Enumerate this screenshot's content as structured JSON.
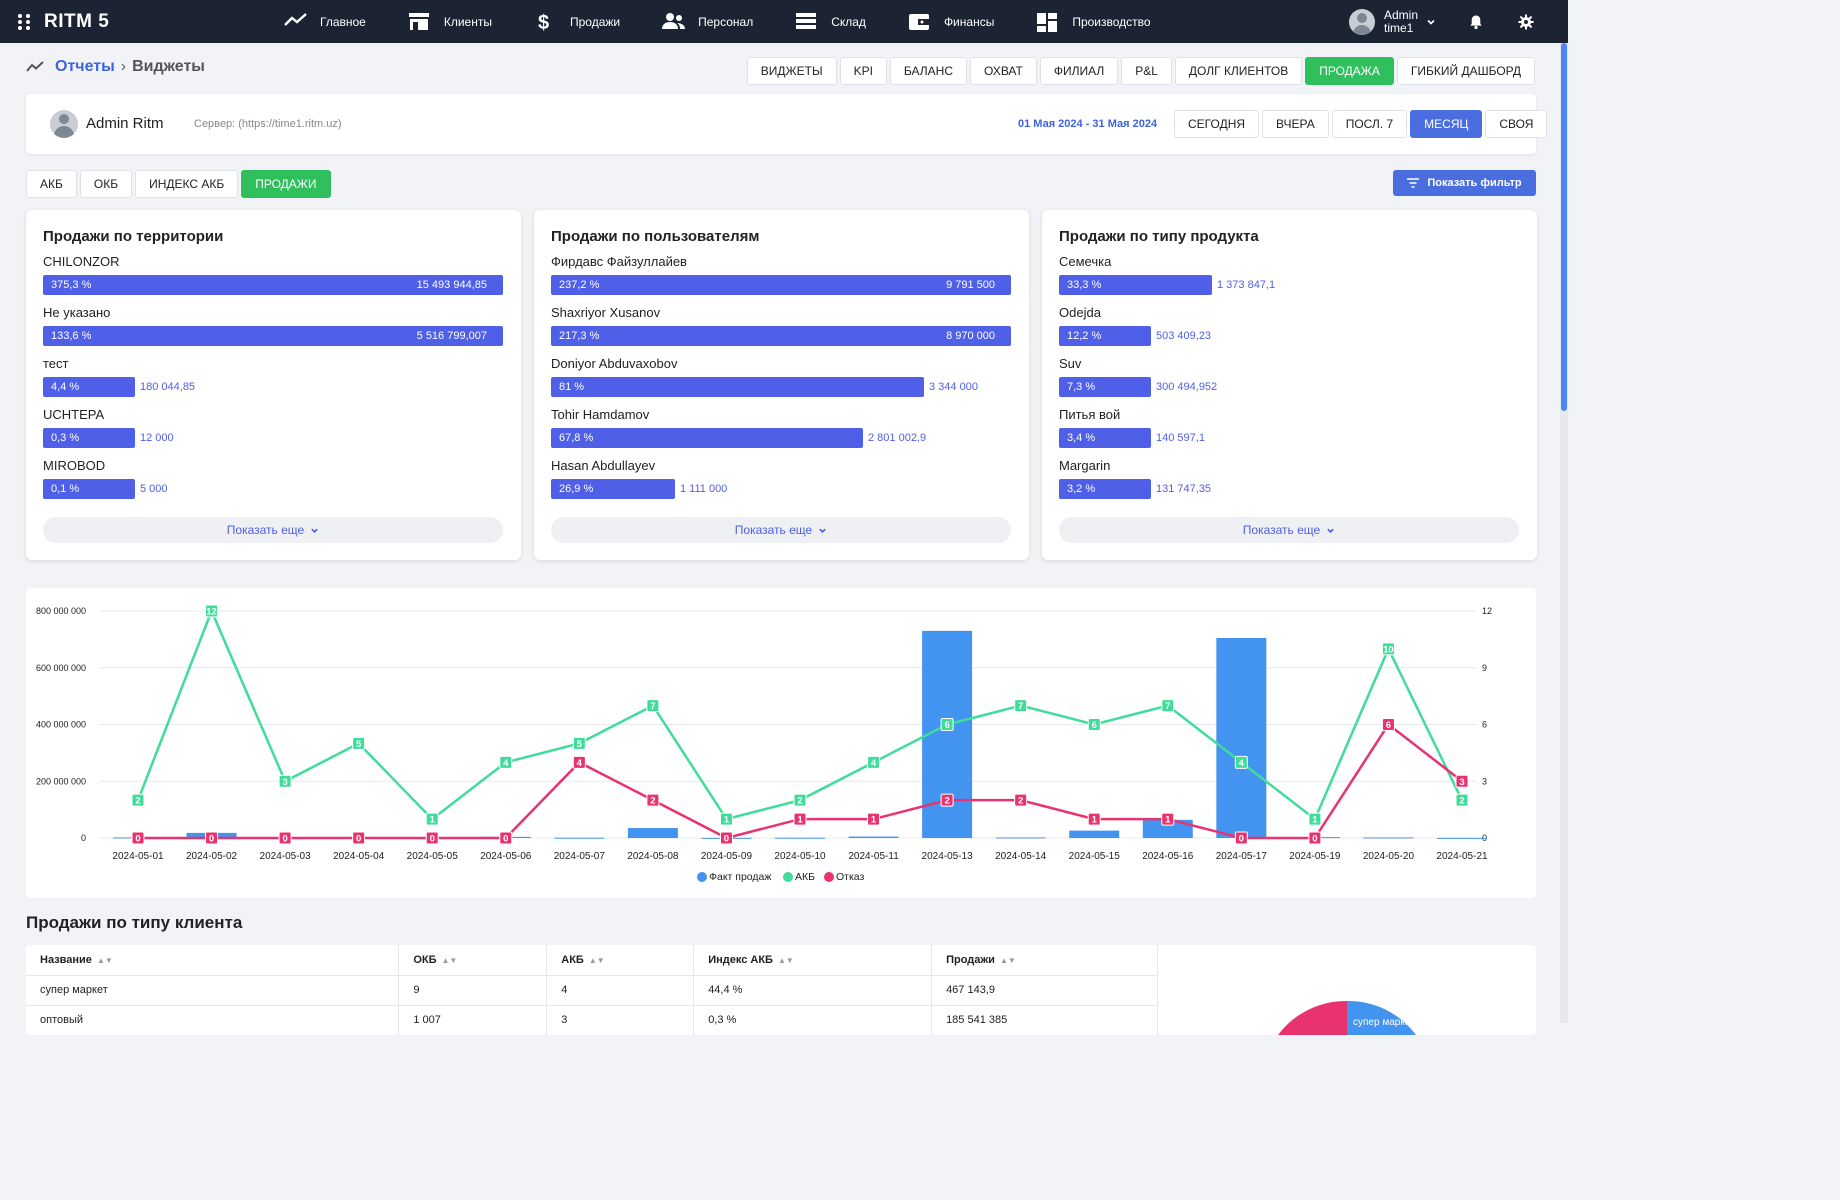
{
  "app": {
    "name": "RITM 5"
  },
  "nav": [
    {
      "label": "Главное",
      "icon": "trend-line-icon"
    },
    {
      "label": "Клиенты",
      "icon": "store-icon"
    },
    {
      "label": "Продажи",
      "icon": "dollar-icon"
    },
    {
      "label": "Персонал",
      "icon": "people-icon"
    },
    {
      "label": "Склад",
      "icon": "warehouse-icon"
    },
    {
      "label": "Финансы",
      "icon": "wallet-icon"
    },
    {
      "label": "Производство",
      "icon": "dashboard-blocks-icon"
    }
  ],
  "user": {
    "name": "Admin",
    "server": "time1"
  },
  "breadcrumb": {
    "parent": "Отчеты",
    "separator": "›",
    "current": "Виджеты"
  },
  "top_tabs": [
    {
      "label": "ВИДЖЕТЫ",
      "active": false
    },
    {
      "label": "KPI",
      "active": false
    },
    {
      "label": "БАЛАНС",
      "active": false
    },
    {
      "label": "ОХВАТ",
      "active": false
    },
    {
      "label": "ФИЛИАЛ",
      "active": false
    },
    {
      "label": "P&L",
      "active": false
    },
    {
      "label": "ДОЛГ КЛИЕНТОВ",
      "active": false
    },
    {
      "label": "ПРОДАЖА",
      "active": true
    },
    {
      "label": "ГИБКИЙ ДАШБОРД",
      "active": false
    }
  ],
  "user_card": {
    "name": "Admin Ritm",
    "server": "Сервер: (https://time1.ritm.uz)",
    "date_range": "01 Мая 2024 - 31 Мая 2024",
    "periods": [
      {
        "label": "СЕГОДНЯ",
        "active": false
      },
      {
        "label": "ВЧЕРА",
        "active": false
      },
      {
        "label": "ПОСЛ. 7",
        "active": false
      },
      {
        "label": "МЕСЯЦ",
        "active": true
      },
      {
        "label": "СВОЯ",
        "active": false
      }
    ]
  },
  "sub_tabs": [
    {
      "label": "АКБ",
      "active": false
    },
    {
      "label": "ОКБ",
      "active": false
    },
    {
      "label": "ИНДЕКС АКБ",
      "active": false
    },
    {
      "label": "ПРОДАЖИ",
      "active": true
    }
  ],
  "filter_button": "Показать фильтр",
  "widgets": [
    {
      "title": "Продажи по территории",
      "more": "Показать еще",
      "rows": [
        {
          "label": "CHILONZOR",
          "pct": "375,3 %",
          "value": "15 493 944,85",
          "fill": 1.0
        },
        {
          "label": "Не указано",
          "pct": "133,6 %",
          "value": "5 516 799,007",
          "fill": 1.0
        },
        {
          "label": "тест",
          "pct": "4,4 %",
          "value": "180 044,85",
          "fill": 0.2
        },
        {
          "label": "UCHTEPA",
          "pct": "0,3 %",
          "value": "12 000",
          "fill": 0.2
        },
        {
          "label": "MIROBOD",
          "pct": "0,1 %",
          "value": "5 000",
          "fill": 0.2
        }
      ]
    },
    {
      "title": "Продажи по пользователям",
      "more": "Показать еще",
      "rows": [
        {
          "label": "Фирдавс Файзуллайев",
          "pct": "237,2 %",
          "value": "9 791 500",
          "fill": 1.0
        },
        {
          "label": "Shaxriyor Xusanov",
          "pct": "217,3 %",
          "value": "8 970 000",
          "fill": 1.0
        },
        {
          "label": "Doniyor Abduvaxobov",
          "pct": "81 %",
          "value": "3 344 000",
          "fill": 0.81
        },
        {
          "label": "Tohir Hamdamov",
          "pct": "67,8 %",
          "value": "2 801 002,9",
          "fill": 0.678
        },
        {
          "label": "Hasan Abdullayev",
          "pct": "26,9 %",
          "value": "1 111 000",
          "fill": 0.269
        }
      ]
    },
    {
      "title": "Продажи по типу продукта",
      "more": "Показать еще",
      "rows": [
        {
          "label": "Семечка",
          "pct": "33,3 %",
          "value": "1 373 847,1",
          "fill": 0.333
        },
        {
          "label": "Odejda",
          "pct": "12,2 %",
          "value": "503 409,23",
          "fill": 0.2
        },
        {
          "label": "Suv",
          "pct": "7,3 %",
          "value": "300 494,952",
          "fill": 0.2
        },
        {
          "label": "Питья вой",
          "pct": "3,4 %",
          "value": "140 597,1",
          "fill": 0.2
        },
        {
          "label": "Margarin",
          "pct": "3,2 %",
          "value": "131 747,35",
          "fill": 0.2
        }
      ]
    }
  ],
  "chart_data": {
    "type": "bar",
    "categories": [
      "2024-05-01",
      "2024-05-02",
      "2024-05-03",
      "2024-05-04",
      "2024-05-05",
      "2024-05-06",
      "2024-05-07",
      "2024-05-08",
      "2024-05-09",
      "2024-05-10",
      "2024-05-11",
      "2024-05-13",
      "2024-05-14",
      "2024-05-15",
      "2024-05-16",
      "2024-05-17",
      "2024-05-19",
      "2024-05-20",
      "2024-05-21"
    ],
    "series": [
      {
        "name": "Факт продаж",
        "type": "bar",
        "axis": "left",
        "color": "#4393f0",
        "values": [
          2000000,
          18000000,
          2000000,
          2000000,
          1000000,
          4000000,
          1000000,
          35000000,
          500000,
          1000000,
          5000000,
          730000000,
          2000000,
          26000000,
          64000000,
          705000000,
          3000000,
          2000000,
          500000
        ]
      },
      {
        "name": "АКБ",
        "type": "line",
        "axis": "right",
        "color": "#3fdc9a",
        "values": [
          2,
          12,
          3,
          5,
          1,
          4,
          5,
          7,
          1,
          2,
          4,
          6,
          7,
          6,
          7,
          4,
          1,
          10,
          2
        ]
      },
      {
        "name": "Отказ",
        "type": "line",
        "axis": "right",
        "color": "#e8336e",
        "values": [
          0,
          0,
          0,
          0,
          0,
          0,
          4,
          2,
          0,
          1,
          1,
          2,
          2,
          1,
          1,
          0,
          0,
          6,
          3
        ]
      }
    ],
    "y_left": {
      "min": 0,
      "max": 800000000,
      "ticks": [
        "800 000 000",
        "600 000 000",
        "400 000 000",
        "200 000 000",
        "0"
      ]
    },
    "y_right": {
      "min": 0,
      "max": 12,
      "ticks": [
        "12",
        "9",
        "6",
        "3",
        "0"
      ]
    },
    "legend_position": "bottom",
    "grid": true
  },
  "client_table": {
    "title": "Продажи по типу клиента",
    "columns": [
      "Название",
      "ОКБ",
      "АКБ",
      "Индекс АКБ",
      "Продажи"
    ],
    "rows": [
      [
        "супер маркет",
        "9",
        "4",
        "44,4 %",
        "467 143,9"
      ],
      [
        "оптовый",
        "1 007",
        "3",
        "0,3 %",
        "185 541 385"
      ]
    ],
    "pie_label": "супер маркет"
  }
}
